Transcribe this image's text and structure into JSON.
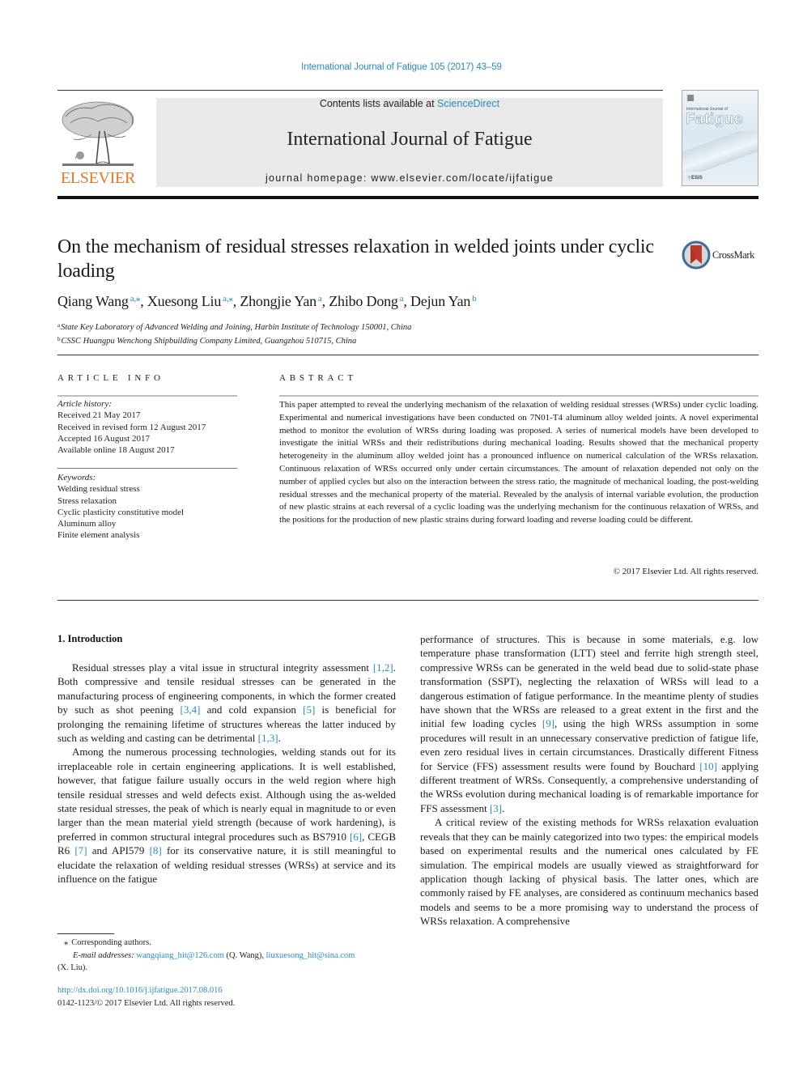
{
  "running_header": "International Journal of Fatigue 105 (2017) 43–59",
  "masthead": {
    "publisher": "ELSEVIER",
    "contents_prefix": "Contents lists available at ",
    "contents_link": "ScienceDirect",
    "journal_title": "International Journal of Fatigue",
    "homepage_prefix": "journal homepage: ",
    "homepage_url": "www.elsevier.com/locate/ijfatigue"
  },
  "cover": {
    "small_text": "International Journal of",
    "big_text": "Fatigue"
  },
  "crossmark_label": "CrossMark",
  "article": {
    "title": "On the mechanism of residual stresses relaxation in welded joints under cyclic loading",
    "authors": [
      {
        "name": "Qiang Wang",
        "sup": "a,⁎"
      },
      {
        "name": "Xuesong Liu",
        "sup": "a,⁎"
      },
      {
        "name": "Zhongjie Yan",
        "sup": "a"
      },
      {
        "name": "Zhibo Dong",
        "sup": "a"
      },
      {
        "name": "Dejun Yan",
        "sup": "b"
      }
    ],
    "affiliations": [
      {
        "mark": "a",
        "text": "State Key Laboratory of Advanced Welding and Joining, Harbin Institute of Technology 150001, China"
      },
      {
        "mark": "b",
        "text": "CSSC Huangpu Wenchong Shipbuilding Company Limited, Guangzhou 510715, China"
      }
    ]
  },
  "article_info": {
    "heading": "ARTICLE INFO",
    "history_label": "Article history:",
    "history": [
      "Received 21 May 2017",
      "Received in revised form 12 August 2017",
      "Accepted 16 August 2017",
      "Available online 18 August 2017"
    ],
    "keywords_label": "Keywords:",
    "keywords": [
      "Welding residual stress",
      "Stress relaxation",
      "Cyclic plasticity constitutive model",
      "Aluminum alloy",
      "Finite element analysis"
    ]
  },
  "abstract": {
    "heading": "ABSTRACT",
    "text": "This paper attempted to reveal the underlying mechanism of the relaxation of welding residual stresses (WRSs) under cyclic loading. Experimental and numerical investigations have been conducted on 7N01-T4 aluminum alloy welded joints. A novel experimental method to monitor the evolution of WRSs during loading was proposed. A series of numerical models have been developed to investigate the initial WRSs and their redistributions during mechanical loading. Results showed that the mechanical property heterogeneity in the aluminum alloy welded joint has a pronounced influence on numerical calculation of the WRSs relaxation. Continuous relaxation of WRSs occurred only under certain circumstances. The amount of relaxation depended not only on the number of applied cycles but also on the interaction between the stress ratio, the magnitude of mechanical loading, the post-welding residual stresses and the mechanical property of the material. Revealed by the analysis of internal variable evolution, the production of new plastic strains at each reversal of a cyclic loading was the underlying mechanism for the continuous relaxation of WRSs, and the positions for the production of new plastic strains during forward loading and reverse loading could be different.",
    "copyright": "© 2017 Elsevier Ltd. All rights reserved."
  },
  "body": {
    "intro_heading": "1. Introduction",
    "p1": [
      {
        "t": "Residual stresses play a vital issue in structural integrity assessment "
      },
      {
        "ref": "[1,2]"
      },
      {
        "t": ". Both compressive and tensile residual stresses can be generated in the manufacturing process of engineering components, in which the former created by such as shot peening "
      },
      {
        "ref": "[3,4]"
      },
      {
        "t": " and cold expansion "
      },
      {
        "ref": "[5]"
      },
      {
        "t": " is beneficial for prolonging the remaining lifetime of structures whereas the latter induced by such as welding and casting can be detrimental "
      },
      {
        "ref": "[1,3]"
      },
      {
        "t": "."
      }
    ],
    "p2": [
      {
        "t": "Among the numerous processing technologies, welding stands out for its irreplaceable role in certain engineering applications. It is well established, however, that fatigue failure usually occurs in the weld region where high tensile residual stresses and weld defects exist. Although using the as-welded state residual stresses, the peak of which is nearly equal in magnitude to or even larger than the mean material yield strength (because of work hardening), is preferred in common structural integral procedures such as BS7910 "
      },
      {
        "ref": "[6]"
      },
      {
        "t": ", CEGB R6 "
      },
      {
        "ref": "[7]"
      },
      {
        "t": " and API579 "
      },
      {
        "ref": "[8]"
      },
      {
        "t": " for its conservative nature, it is still meaningful to elucidate the relaxation of welding residual stresses (WRSs) at service and its influence on the fatigue "
      }
    ],
    "p2_cont": [
      {
        "t": "performance of structures. This is because in some materials, e.g. low temperature phase transformation (LTT) steel and ferrite high strength steel, compressive WRSs can be generated in the weld bead due to solid-state phase transformation (SSPT), neglecting the relaxation of WRSs will lead to a dangerous estimation of fatigue performance. In the meantime plenty of studies have shown that the WRSs are released to a great extent in the first and the initial few loading cycles "
      },
      {
        "ref": "[9]"
      },
      {
        "t": ", using the high WRSs assumption in some procedures will result in an unnecessary conservative prediction of fatigue life, even zero residual lives in certain circumstances. Drastically different Fitness for Service (FFS) assessment results were found by Bouchard "
      },
      {
        "ref": "[10]"
      },
      {
        "t": " applying different treatment of WRSs. Consequently, a comprehensive understanding of the WRSs evolution during mechanical loading is of remarkable importance for FFS assessment "
      },
      {
        "ref": "[3]"
      },
      {
        "t": "."
      }
    ],
    "p3": [
      {
        "t": "A critical review of the existing methods for WRSs relaxation evaluation reveals that they can be mainly categorized into two types: the empirical models based on experimental results and the numerical ones calculated by FE simulation. The empirical models are usually viewed as straightforward for application though lacking of physical basis. The latter ones, which are commonly raised by FE analyses, are considered as continuum mechanics based models and seems to be a more promising way to understand the process of WRSs relaxation. A comprehensive"
      }
    ]
  },
  "footnotes": {
    "star": "⁎",
    "corresponding": "Corresponding authors.",
    "email_label": "E-mail addresses:",
    "emails": [
      {
        "address": "wangqiang_hit@126.com",
        "who": " (Q. Wang), "
      },
      {
        "address": "liuxuesong_hit@sina.com",
        "who": ""
      }
    ],
    "email_tail": "(X. Liu)."
  },
  "doi": {
    "url": "http://dx.doi.org/10.1016/j.ijfatigue.2017.08.016",
    "issn_line": "0142-1123/© 2017 Elsevier Ltd. All rights reserved."
  },
  "colors": {
    "link": "#2a8ab6",
    "elsevier_orange": "#e87722",
    "masthead_gray": "#e9e9e9"
  }
}
